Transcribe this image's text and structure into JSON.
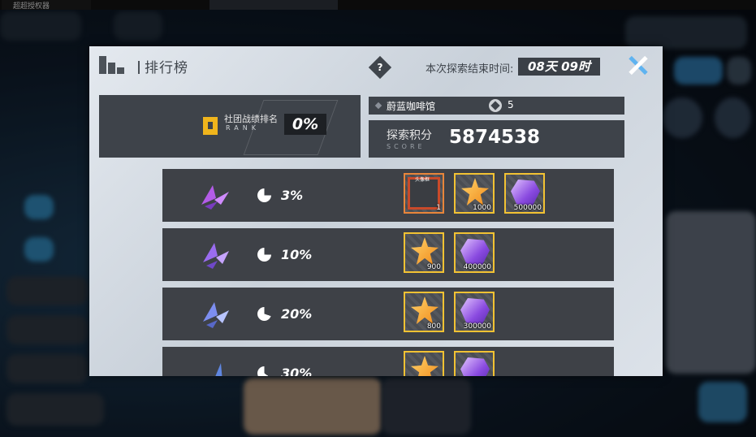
{
  "window": {
    "tab_title": "超超授权器"
  },
  "header": {
    "title": "排行榜",
    "help_icon": "question-diamond-icon",
    "end_time_label": "本次探索结束时间:",
    "end_time_value": "08天 09时",
    "close_icon": "close-x-icon"
  },
  "rank": {
    "label_cn": "社团战绩排名",
    "label_en": "RANK",
    "value": "0%",
    "icon": "bookmark-rank-icon"
  },
  "club": {
    "name": "蔚蓝咖啡馆",
    "member_icon": "heart-badge-icon",
    "count": "5"
  },
  "score": {
    "label_cn": "探索积分",
    "label_en": "SCORE",
    "value": "5874538"
  },
  "tiers": [
    {
      "percent": "3%",
      "rewards": [
        {
          "type": "frame",
          "tag": "头像框",
          "qty": "1"
        },
        {
          "type": "star",
          "qty": "1000"
        },
        {
          "type": "crystal",
          "qty": "500000"
        }
      ]
    },
    {
      "percent": "10%",
      "rewards": [
        {
          "type": "star",
          "qty": "900"
        },
        {
          "type": "crystal",
          "qty": "400000"
        }
      ]
    },
    {
      "percent": "20%",
      "rewards": [
        {
          "type": "star",
          "qty": "800"
        },
        {
          "type": "crystal",
          "qty": "300000"
        }
      ]
    },
    {
      "percent": "30%",
      "rewards": [
        {
          "type": "star",
          "qty": ""
        },
        {
          "type": "crystal",
          "qty": ""
        }
      ]
    }
  ],
  "colors": {
    "panel_dark": "#3e434a",
    "accent_gold": "#f2c233",
    "accent_blue": "#5fb3f0"
  }
}
